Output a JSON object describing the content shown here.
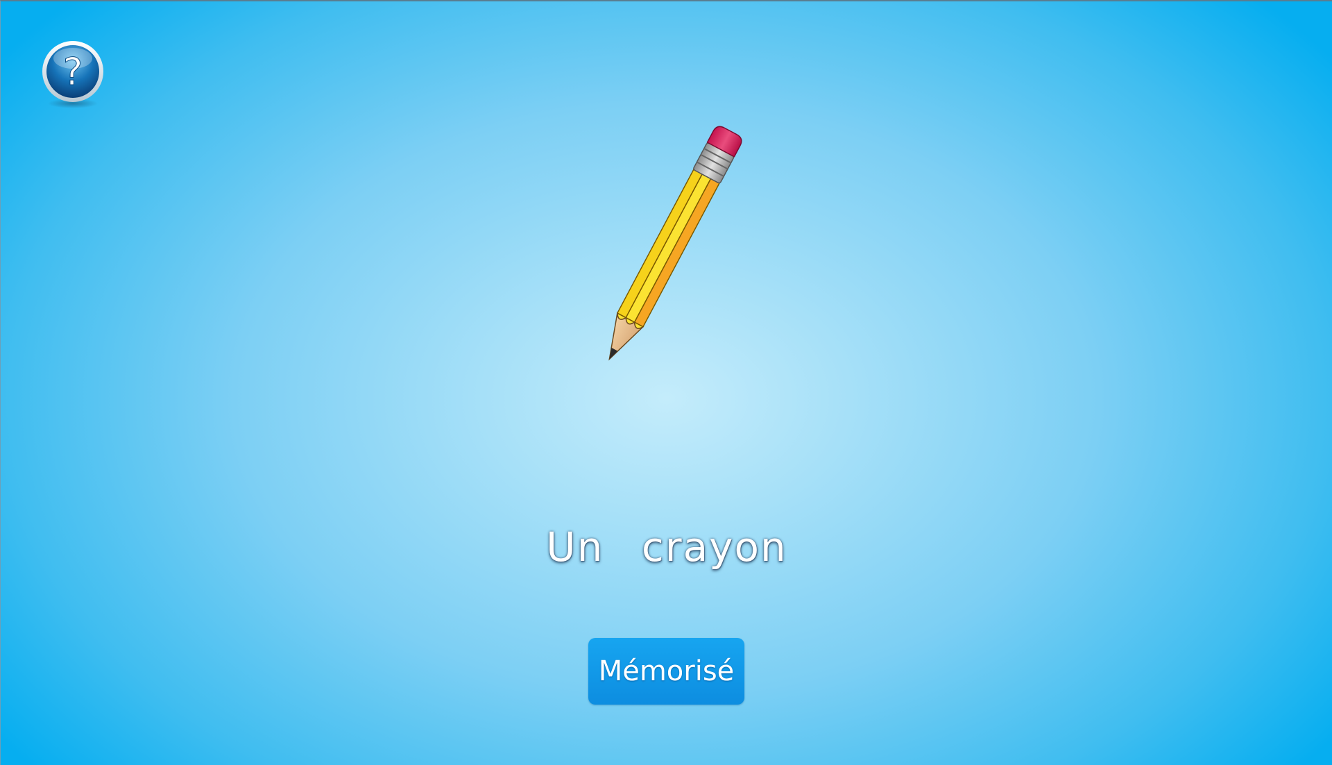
{
  "help": {
    "icon": "question-mark-icon",
    "glyph": "?"
  },
  "card": {
    "image": "pencil-icon",
    "word": "Un crayon"
  },
  "actions": {
    "memorize_label": "Mémorisé"
  },
  "colors": {
    "background_center": "#c4ecfb",
    "background_edge": "#06aef0",
    "button": "#0d8de0",
    "text": "#ffffff"
  }
}
